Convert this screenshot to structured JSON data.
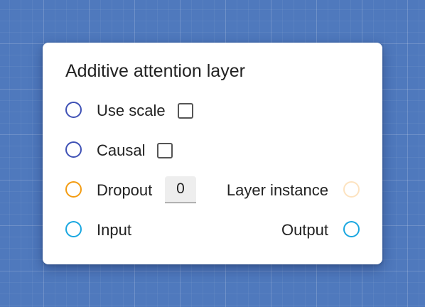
{
  "node": {
    "title": "Additive attention layer",
    "rows": {
      "use_scale": {
        "label": "Use scale",
        "checked": false
      },
      "causal": {
        "label": "Causal",
        "checked": false
      },
      "dropout": {
        "label": "Dropout",
        "value": "0"
      },
      "layer_instance": {
        "label": "Layer instance"
      },
      "input": {
        "label": "Input"
      },
      "output": {
        "label": "Output"
      }
    }
  },
  "colors": {
    "canvas_background": "#4f79bd",
    "socket_blue": "#3f51b5",
    "socket_orange": "#f39c12",
    "socket_orange_faint": "#fde3c0",
    "socket_cyan": "#1aa7e0"
  }
}
